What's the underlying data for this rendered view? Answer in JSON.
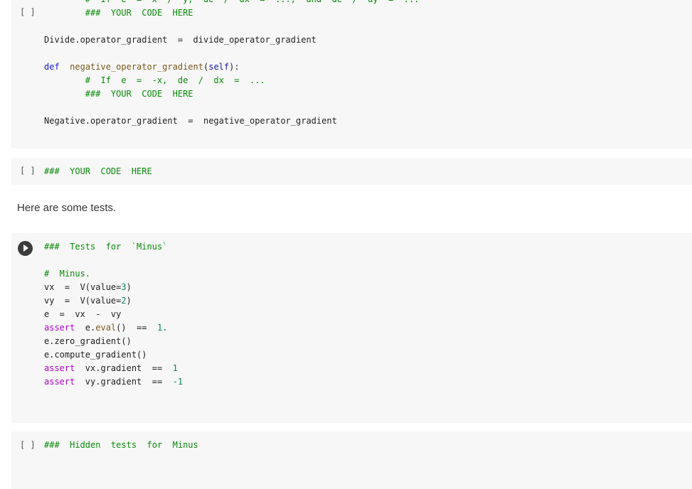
{
  "cells": [
    {
      "bracket": "[ ]",
      "lines": [
        [
          [
            "        #  If  e  =  x  /  y,  de  /  dx  =  ...,  and  de  /  dy  =  ...",
            "cm"
          ]
        ],
        [
          [
            "        ###  YOUR  CODE  HERE",
            "cm"
          ]
        ],
        [],
        [
          [
            "Divide.operator_gradient  =  divide_operator_gradient",
            ""
          ]
        ],
        [],
        [
          [
            "def",
            "kw"
          ],
          [
            "  ",
            ""
          ],
          [
            "negative_operator_gradient",
            "fn"
          ],
          [
            "(",
            ""
          ],
          [
            "self",
            "sf"
          ],
          [
            "):",
            ""
          ]
        ],
        [
          [
            "        #  If  e  =  -x,  de  /  dx  =  ...",
            "cm"
          ]
        ],
        [
          [
            "        ###  YOUR  CODE  HERE",
            "cm"
          ]
        ],
        [],
        [
          [
            "Negative.operator_gradient  =  negative_operator_gradient",
            ""
          ]
        ]
      ]
    },
    {
      "bracket": "[ ]",
      "lines": [
        [
          [
            "###  YOUR  CODE  HERE",
            "cm"
          ]
        ]
      ]
    },
    {
      "run": "run-cell",
      "lines": [
        [
          [
            "###  Tests  for  `Minus`",
            "cm"
          ]
        ],
        [],
        [
          [
            "#  Minus.",
            "cm"
          ]
        ],
        [
          [
            "vx  =  V(value=",
            ""
          ],
          [
            "3",
            "nm"
          ],
          [
            ")",
            ""
          ]
        ],
        [
          [
            "vy  =  V(value=",
            ""
          ],
          [
            "2",
            "nm"
          ],
          [
            ")",
            ""
          ]
        ],
        [
          [
            "e  =  vx  -  vy",
            ""
          ]
        ],
        [
          [
            "assert",
            "as"
          ],
          [
            "  e.",
            ""
          ],
          [
            "eval",
            "fn"
          ],
          [
            "()  ==  ",
            ""
          ],
          [
            "1.",
            "nm"
          ]
        ],
        [
          [
            "e.zero_gradient()",
            ""
          ]
        ],
        [
          [
            "e.compute_gradient()",
            ""
          ]
        ],
        [
          [
            "assert",
            "as"
          ],
          [
            "  vx.gradient  ==  ",
            ""
          ],
          [
            "1",
            "nm"
          ]
        ],
        [
          [
            "assert",
            "as"
          ],
          [
            "  vy.gradient  ==  ",
            ""
          ],
          [
            "-1",
            "nm"
          ]
        ]
      ]
    },
    {
      "bracket": "[ ]",
      "lines": [
        [
          [
            "###  Hidden  tests  for  Minus",
            "cm"
          ]
        ]
      ]
    }
  ],
  "markdown": "Here are some tests."
}
